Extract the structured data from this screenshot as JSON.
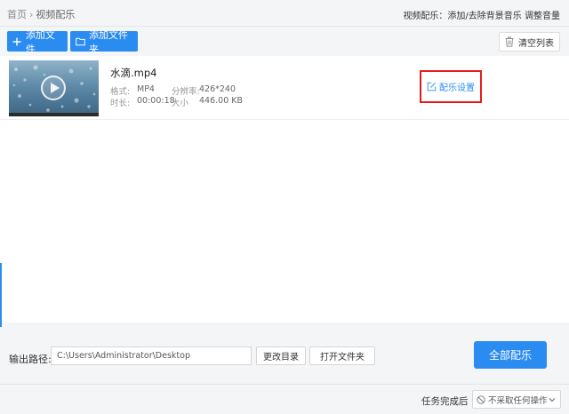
{
  "breadcrumb": {
    "home": "首页",
    "separator": "›",
    "current": "视频配乐"
  },
  "header_hint": "视频配乐：添加/去除背景音乐 调整音量",
  "toolbar": {
    "add_file_label": "添加文件",
    "add_folder_label": "添加文件夹",
    "clear_list_label": "清空列表"
  },
  "files": [
    {
      "name": "水滴.mp4",
      "format_label": "格式:",
      "format_value": "MP4",
      "resolution_label": "分辨率:",
      "resolution_value": "426*240",
      "duration_label": "时长:",
      "duration_value": "00:00:18",
      "size_label": "大小",
      "size_value": "446.00 KB",
      "settings_label": "配乐设置"
    }
  ],
  "output": {
    "label": "输出路径:",
    "path": "C:\\Users\\Administrator\\Desktop",
    "change_dir_label": "更改目录",
    "open_folder_label": "打开文件夹",
    "start_all_label": "全部配乐"
  },
  "footer": {
    "after_task_label": "任务完成后",
    "after_task_value": "不采取任何操作"
  },
  "colors": {
    "accent": "#2a8cf0",
    "highlight_box": "#e81b1b",
    "background": "#f4f5f7"
  },
  "icons": {
    "add_file": "plus-icon",
    "add_folder": "folder-icon",
    "clear_list": "trash-icon",
    "play": "play-icon",
    "settings": "edit-icon",
    "after_task": "no-action-icon",
    "dropdown": "chevron-down-icon"
  }
}
